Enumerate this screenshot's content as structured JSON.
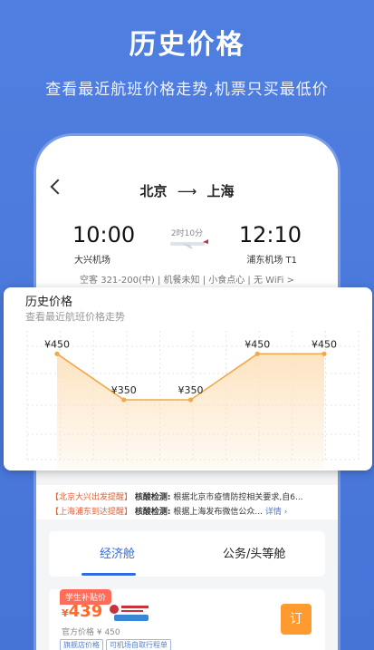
{
  "promo": {
    "title": "历史价格",
    "subtitle": "查看最近航班价格走势,机票只买最低价"
  },
  "flight": {
    "from": "北京",
    "arrow": "⟶",
    "to": "上海",
    "dep_time": "10:00",
    "arr_time": "12:10",
    "dep_airport": "大兴机场",
    "arr_airport": "浦东机场 T1",
    "duration": "2时10分",
    "info": "空客 321-200(中) | 机餐未知 | 小食点心 | 无 WiFi >"
  },
  "price_history": {
    "title": "历史价格",
    "subtitle": "查看最近航班价格走势"
  },
  "chart_data": {
    "type": "area",
    "title": "历史价格",
    "subtitle": "查看最近航班价格走势",
    "x": [
      1,
      2,
      3,
      4,
      5
    ],
    "values": [
      450,
      350,
      350,
      450,
      450
    ],
    "data_labels": [
      "¥450",
      "¥350",
      "¥350",
      "¥450",
      "¥450"
    ],
    "ylim": [
      200,
      500
    ],
    "grid": true,
    "line_color": "#f0a948",
    "fill_color": "#fde2bf"
  },
  "notices": [
    {
      "tag": "【北京大兴出发提醒】",
      "label": "核酸检测:",
      "text": "根据北京市疫情防控相关要求,自6...",
      "more": ""
    },
    {
      "tag": "【上海浦东到达提醒】",
      "label": "核酸检测:",
      "text": "根据上海发布微信公众...",
      "more": "详情 ›"
    }
  ],
  "tabs": [
    {
      "label": "经济舱"
    },
    {
      "label": "公务/头等舱"
    }
  ],
  "offer": {
    "badge": "学生补贴价",
    "currency": "¥",
    "price": "439",
    "official": "官方价格 ¥ 450",
    "chips": [
      "旗舰店价格",
      "可机场自取行程单"
    ],
    "book": "订"
  },
  "colors": {
    "background": "#4f7fe0",
    "accent": "#2f6be0",
    "price": "#ff6a2a",
    "book_button": "#ff9a2e"
  }
}
